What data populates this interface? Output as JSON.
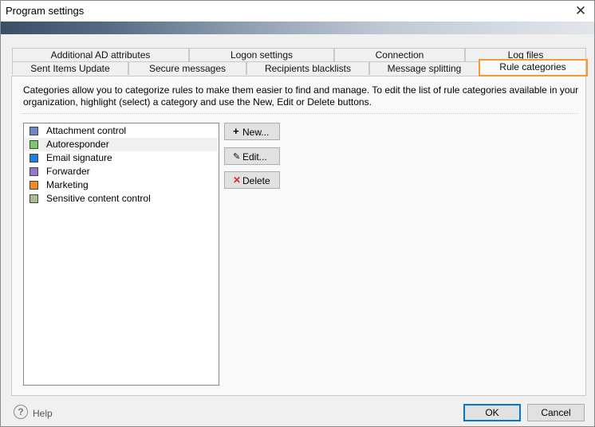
{
  "window": {
    "title": "Program settings"
  },
  "tabs": {
    "row_back": [
      {
        "label": "Additional AD attributes"
      },
      {
        "label": "Logon settings"
      },
      {
        "label": "Connection"
      },
      {
        "label": "Log files"
      }
    ],
    "row_front": [
      {
        "label": "Sent Items Update"
      },
      {
        "label": "Secure messages"
      },
      {
        "label": "Recipients blacklists"
      },
      {
        "label": "Message splitting"
      },
      {
        "label": "Rule categories",
        "active": true
      }
    ],
    "highlight_color": "#f39a36"
  },
  "panel": {
    "description": "Categories allow you to categorize rules to make them easier to find and manage. To edit the list of rule categories available in your organization, highlight (select) a category and use the New, Edit or Delete buttons."
  },
  "categories": [
    {
      "label": "Attachment control",
      "color": "#6f86c9"
    },
    {
      "label": "Autoresponder",
      "color": "#7bc86f",
      "selected": true
    },
    {
      "label": "Email signature",
      "color": "#1f7fe0"
    },
    {
      "label": "Forwarder",
      "color": "#9575cd"
    },
    {
      "label": "Marketing",
      "color": "#f58a1f"
    },
    {
      "label": "Sensitive content control",
      "color": "#a9bd8d"
    }
  ],
  "buttons": {
    "new": {
      "label": "New...",
      "icon": "plus-icon"
    },
    "edit": {
      "label": "Edit...",
      "icon": "pencil-icon"
    },
    "delete": {
      "label": "Delete",
      "icon": "delete-x-icon",
      "icon_color": "#d32f2f"
    }
  },
  "footer": {
    "help": "Help",
    "ok": "OK",
    "cancel": "Cancel"
  }
}
